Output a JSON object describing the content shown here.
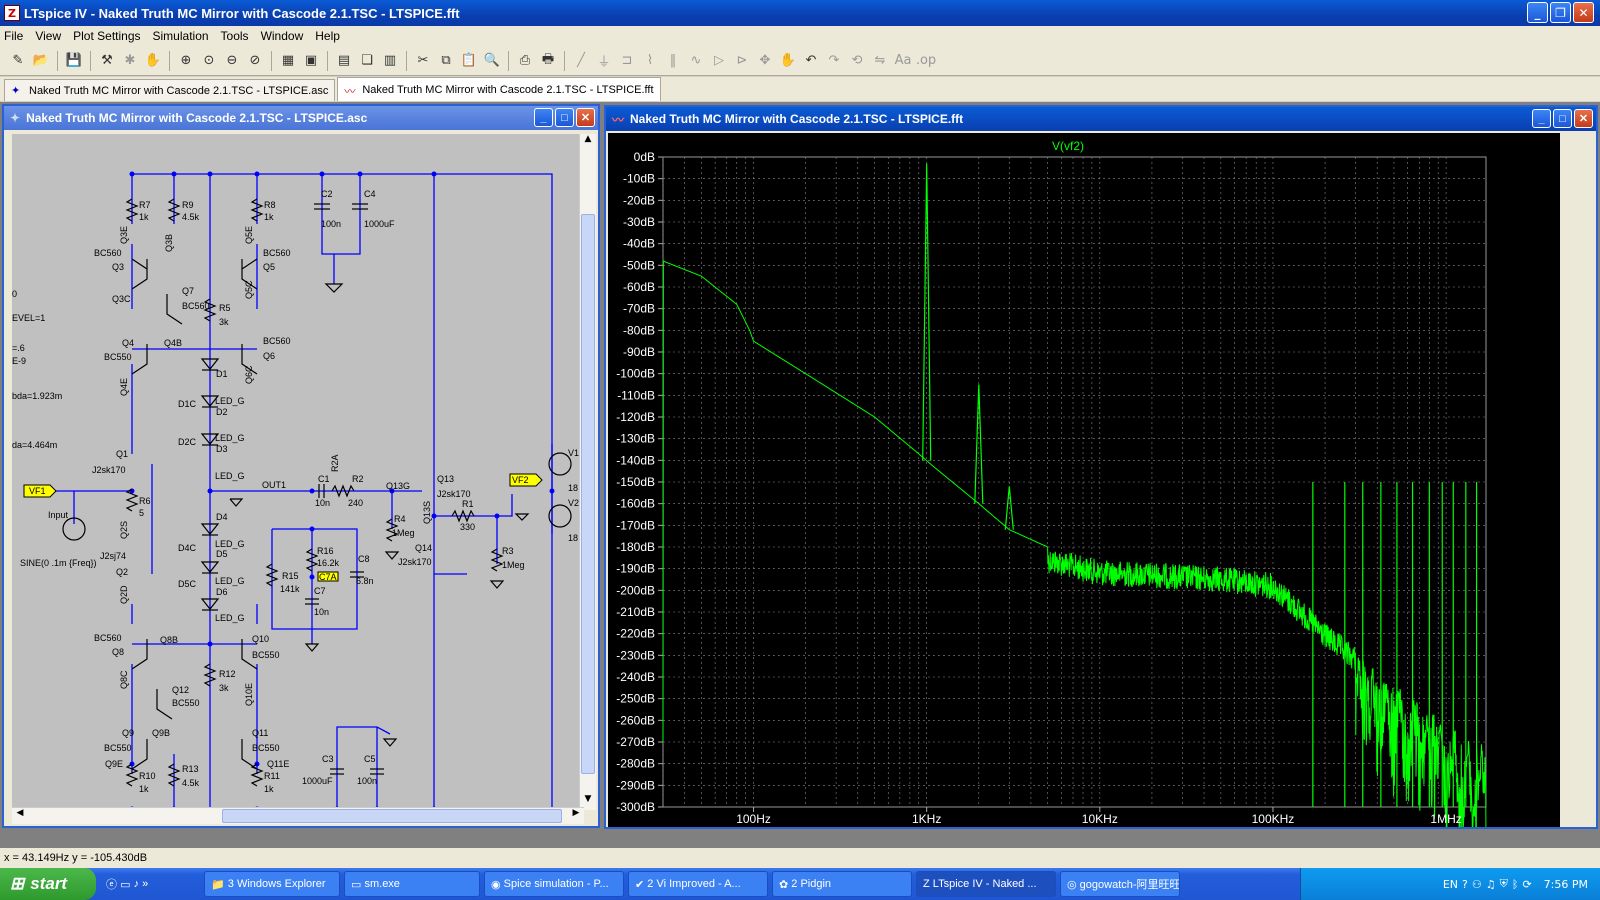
{
  "app_title": "LTspice IV - Naked Truth MC Mirror with Cascode 2.1.TSC - LTSPICE.fft",
  "menu": [
    "File",
    "View",
    "Plot Settings",
    "Simulation",
    "Tools",
    "Window",
    "Help"
  ],
  "tabs": [
    {
      "label": "Naked Truth MC Mirror with Cascode 2.1.TSC - LTSPICE.asc",
      "active": false
    },
    {
      "label": "Naked Truth MC Mirror with Cascode 2.1.TSC - LTSPICE.fft",
      "active": true
    }
  ],
  "schematic_window": {
    "title": "Naked Truth MC Mirror with Cascode 2.1.TSC - LTSPICE.asc"
  },
  "plot_window": {
    "title": "Naked Truth MC Mirror with Cascode 2.1.TSC - LTSPICE.fft"
  },
  "schematic_labels": {
    "r7": "R7",
    "r7v": "1k",
    "r9": "R9",
    "r9v": "4.5k",
    "r8": "R8",
    "r8v": "1k",
    "c2": "C2",
    "c2v": "100n",
    "c4": "C4",
    "c4v": "1000uF",
    "bc560a": "BC560",
    "q3": "Q3",
    "q3e": "Q3E",
    "q3b": "Q3B",
    "q5e": "Q5E",
    "q5": "Q5",
    "bc560b": "BC560",
    "q3c": "Q3C",
    "q7": "Q7",
    "bc560c": "BC560",
    "r5": "R5",
    "r5v": "3k",
    "q5c": "Q5C",
    "level": "EVEL=1",
    "left1": "0",
    "left2": "=.6",
    "left3": "E-9",
    "bda": "bda=1.923m",
    "da": "da=4.464m",
    "q4": "Q4",
    "bc550a": "BC550",
    "q4b": "Q4B",
    "bc560d": "BC560",
    "q6": "Q6",
    "q4e": "Q4E",
    "q6c": "Q6C",
    "d1": "D1",
    "led1": "LED_G",
    "d1c": "D1C",
    "d2": "D2",
    "led2": "LED_G",
    "d2c": "D2C",
    "d3": "D3",
    "led3": "LED_G",
    "q1": "Q1",
    "j1": "J2sk170",
    "r6": "R6",
    "r6v": "5",
    "vf1": "VF1",
    "input": "Input",
    "q2s": "Q2S",
    "j2": "J2sj74",
    "q2": "Q2",
    "sine": "SINE(0 .1m {Freq})",
    "q2d": "Q2D",
    "out1": "OUT1",
    "c1": "C1",
    "c1v": "10n",
    "r2a": "R2A",
    "r2": "R2",
    "r2v": "240",
    "q13g": "Q13G",
    "r4": "R4",
    "r4v": "1Meg",
    "q13": "Q13",
    "j3": "J2sk170",
    "q13s": "Q13S",
    "r1": "R1",
    "r1v": "330",
    "vf2": "VF2",
    "v1": "V1",
    "v1v": "18",
    "v2": "V2",
    "v2v": "18",
    "r3": "R3",
    "r3v": "1Meg",
    "q14": "Q14",
    "j4": "J2sk170",
    "d4": "D4",
    "led4": "LED_G",
    "d4c": "D4C",
    "d5": "D5",
    "led5": "LED_G",
    "d5c": "D5C",
    "d6": "D6",
    "led6": "LED_G",
    "r16": "R16",
    "r16v": "16.2k",
    "r15": "R15",
    "r15v": "141k",
    "c7a": "C7A",
    "c7": "C7",
    "c7v": "10n",
    "c8": "C8",
    "c8v": "6.8n",
    "bc560e": "BC560",
    "q8": "Q8",
    "q8b": "Q8B",
    "q10": "Q10",
    "bc550b": "BC550",
    "q8c": "Q8C",
    "q12": "Q12",
    "bc550c": "BC550",
    "r12": "R12",
    "r12v": "3k",
    "q10e": "Q10E",
    "q9": "Q9",
    "bc550d": "BC550",
    "q9b": "Q9B",
    "q11": "Q11",
    "bc550e": "BC550",
    "q9e": "Q9E",
    "q11e": "Q11E",
    "r10": "R10",
    "r10v": "1k",
    "r13": "R13",
    "r13v": "4.5k",
    "r11": "R11",
    "r11v": "1k",
    "c3": "C3",
    "c3v": "1000uF",
    "c5": "C5",
    "c5v": "100n"
  },
  "chart_data": {
    "type": "line",
    "title": "V(vf2)",
    "xlabel": "",
    "ylabel": "",
    "x_scale": "log",
    "xlim": [
      30,
      1700000
    ],
    "ylim": [
      -300,
      0
    ],
    "x_ticks": [
      "100Hz",
      "1KHz",
      "10KHz",
      "100KHz",
      "1MHz"
    ],
    "y_ticks": [
      "0dB",
      "-10dB",
      "-20dB",
      "-30dB",
      "-40dB",
      "-50dB",
      "-60dB",
      "-70dB",
      "-80dB",
      "-90dB",
      "-100dB",
      "-110dB",
      "-120dB",
      "-130dB",
      "-140dB",
      "-150dB",
      "-160dB",
      "-170dB",
      "-180dB",
      "-190dB",
      "-200dB",
      "-210dB",
      "-220dB",
      "-230dB",
      "-240dB",
      "-250dB",
      "-260dB",
      "-270dB",
      "-280dB",
      "-290dB",
      "-300dB"
    ],
    "grid": true,
    "color": "#00ff00",
    "series": [
      {
        "name": "V(vf2)",
        "x": [
          30,
          50,
          80,
          95,
          100,
          200,
          500,
          900,
          1000,
          1100,
          2000,
          3000,
          5000,
          10000,
          20000,
          50000,
          100000,
          200000,
          500000,
          1000000,
          1600000
        ],
        "y": [
          -48,
          -55,
          -68,
          -80,
          -85,
          -100,
          -120,
          -137,
          -3,
          -143,
          -160,
          -172,
          -180,
          -186,
          -187,
          -189,
          -192,
          -215,
          -240,
          -260,
          -270
        ]
      }
    ]
  },
  "status": {
    "cursor": "x = 43.149Hz   y = -105.430dB"
  },
  "taskbar": {
    "start": "start",
    "items": [
      "3 Windows Explorer",
      "sm.exe",
      "Spice simulation - P...",
      "2 Vi Improved - A...",
      "2 Pidgin",
      "LTspice IV - Naked ...",
      "gogowatch-阿里旺旺"
    ],
    "lang": "EN",
    "clock": "7:56 PM"
  }
}
